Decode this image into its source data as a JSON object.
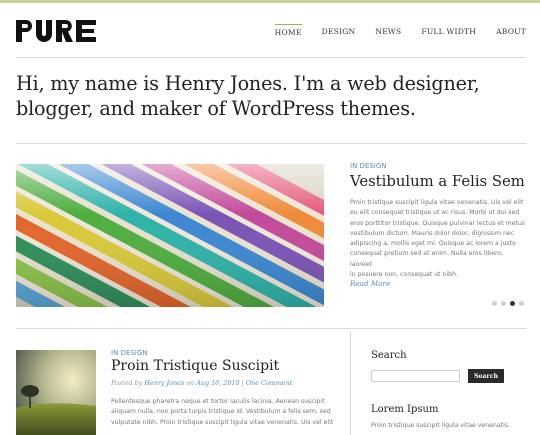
{
  "logo": {
    "text": "PURE"
  },
  "nav": {
    "items": [
      {
        "label": "HOME",
        "active": true
      },
      {
        "label": "DESIGN",
        "active": false
      },
      {
        "label": "NEWS",
        "active": false
      },
      {
        "label": "FULL WIDTH",
        "active": false
      },
      {
        "label": "ABOUT",
        "active": false
      }
    ]
  },
  "hero": {
    "line1": "Hi, my name is Henry Jones. I'm a web designer,",
    "line2": "blogger, and maker of WordPress themes."
  },
  "featured": {
    "category": "IN DESIGN",
    "title": "Vestibulum a Felis Sem",
    "excerpt_lines": [
      "Proin tristique suscipit ligula vitae venenatis. Uis vel elit",
      "eu elit consequat tristique ut ac risus. Morbi ut dui sed",
      "eros porttitor tristique. Quisque pulvinar lectus et metus",
      "vestibulum dictum. Mauris dolor dolor, dignissim nec",
      "adipiscing a, mollis eget mi. Quisque ac lorem a justo",
      "consequat pretium sed at enim. Nulla eros libero, laoreet",
      "in posuere non, consequat ut nibh."
    ],
    "read_more": "Read More",
    "slides": 4,
    "active_slide": 3
  },
  "post": {
    "category": "IN DESIGN",
    "title": "Proin Tristique Suscipit",
    "meta_posted": "Posted by",
    "meta_author": "Henry Jones",
    "meta_on": "on",
    "meta_date": "Aug 16, 2010",
    "meta_sep": "|",
    "meta_comments": "One Comment",
    "excerpt_lines": [
      "Pellentesque pharetra neque et tortor iaculis lacinia. Aenean suscipit",
      "aliquam nulla, non porta turpis tristique id. Vestibulum a felis sem, sed",
      "vulputate nibh. Proin tristique suscipit ligula vitae venenatis. Uis vel elit"
    ]
  },
  "sidebar": {
    "search_heading": "Search",
    "search_value": "",
    "search_button": "Search",
    "lorem_heading": "Lorem Ipsum",
    "lorem_text": "Proin tristique suscipit ligula vitae venenatis."
  },
  "colors": {
    "accent_bar": "#c5d49a",
    "link": "#5b8fb0",
    "button": "#2b2b2b"
  }
}
